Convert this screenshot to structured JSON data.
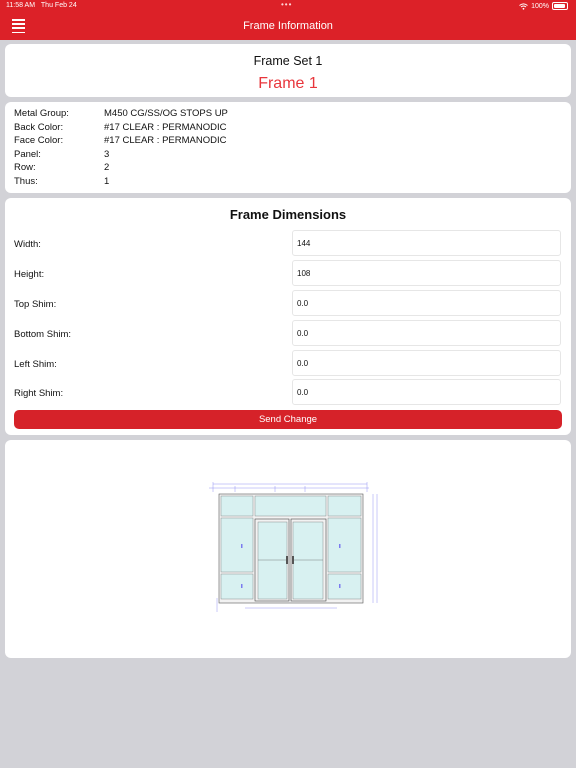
{
  "status_bar": {
    "time": "11:58 AM",
    "date": "Thu Feb 24",
    "battery": "100%"
  },
  "nav": {
    "title": "Frame Information"
  },
  "header": {
    "set_title": "Frame Set 1",
    "frame_title": "Frame 1"
  },
  "info": [
    {
      "label": "Metal Group:",
      "value": "M450 CG/SS/OG STOPS UP"
    },
    {
      "label": "Back Color:",
      "value": "#17 CLEAR : PERMANODIC"
    },
    {
      "label": "Face Color:",
      "value": "#17 CLEAR : PERMANODIC"
    },
    {
      "label": "Panel:",
      "value": "3"
    },
    {
      "label": "Row:",
      "value": "2"
    },
    {
      "label": "Thus:",
      "value": "1"
    }
  ],
  "dimensions": {
    "title": "Frame Dimensions",
    "fields": [
      {
        "label": "Width:",
        "value": "144"
      },
      {
        "label": "Height:",
        "value": "108"
      },
      {
        "label": "Top Shim:",
        "value": "0.0"
      },
      {
        "label": "Bottom Shim:",
        "value": "0.0"
      },
      {
        "label": "Left Shim:",
        "value": "0.0"
      },
      {
        "label": "Right Shim:",
        "value": "0.0"
      }
    ],
    "button_label": "Send Change"
  },
  "colors": {
    "accent": "#dc2128",
    "frame_title": "#e8363c",
    "glass": "#d8f1f1",
    "dimension_line": "#7b7bf0"
  }
}
